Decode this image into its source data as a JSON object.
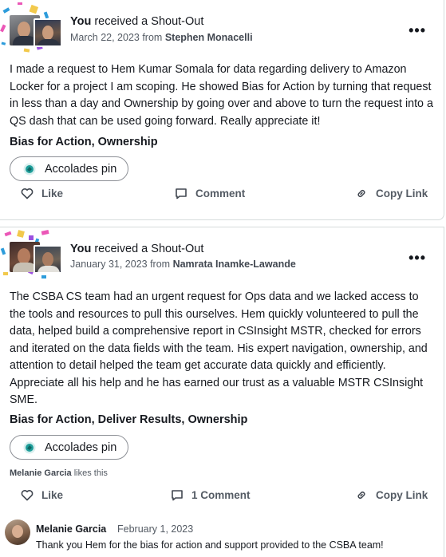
{
  "colors": {
    "text": "#16191f",
    "muted": "#545b64",
    "border": "#d5dbdb",
    "pin_border": "#8d9096",
    "pin_icon": "#1f9e9a",
    "confetti_blue": "#2d9cdb",
    "confetti_yellow": "#f2c94c",
    "confetti_pink": "#eb57b7",
    "confetti_purple": "#9b51e0"
  },
  "posts": [
    {
      "title_bold": "You",
      "title_rest": " received a Shout-Out",
      "date": "March 22, 2023",
      "from_label": " from ",
      "sender": "Stephen Monacelli",
      "more_icon": "more-horizontal-icon",
      "more_label": "•••",
      "body": "I made a request to Hem Kumar Somala for data regarding delivery to Amazon Locker for a project I am scoping. He showed Bias for Action by turning that request in less than a day and Ownership by going over and above to turn the request into a QS dash that can be used going forward. Really appreciate it!",
      "values": "Bias for Action, Ownership",
      "pin_label": "Accolades pin",
      "like_label": "Like",
      "comment_label": "Comment",
      "copy_link_label": "Copy Link"
    },
    {
      "title_bold": "You",
      "title_rest": " received a Shout-Out",
      "date": "January 31, 2023",
      "from_label": " from ",
      "sender": "Namrata Inamke-Lawande",
      "more_icon": "more-horizontal-icon",
      "more_label": "•••",
      "body": "The CSBA CS team had an urgent request for Ops data and we lacked access to the tools and resources to pull this ourselves. Hem quickly volunteered to pull the data, helped build a comprehensive report in CSInsight MSTR, checked for errors and iterated on the data fields with the team. His expert navigation, ownership, and attention to detail helped the team get accurate data quickly and efficiently. Appreciate all his help and he has earned our trust as a valuable MSTR CSInsight SME.",
      "values": "Bias for Action, Deliver Results, Ownership",
      "pin_label": "Accolades pin",
      "likes_name": "Melanie Garcia",
      "likes_suffix": " likes this",
      "like_label": "Like",
      "comment_label": "1 Comment",
      "copy_link_label": "Copy Link",
      "comment": {
        "author": "Melanie Garcia",
        "date": "February 1, 2023",
        "text": "Thank you Hem for the bias for action and support provided to the CSBA team!"
      }
    }
  ]
}
